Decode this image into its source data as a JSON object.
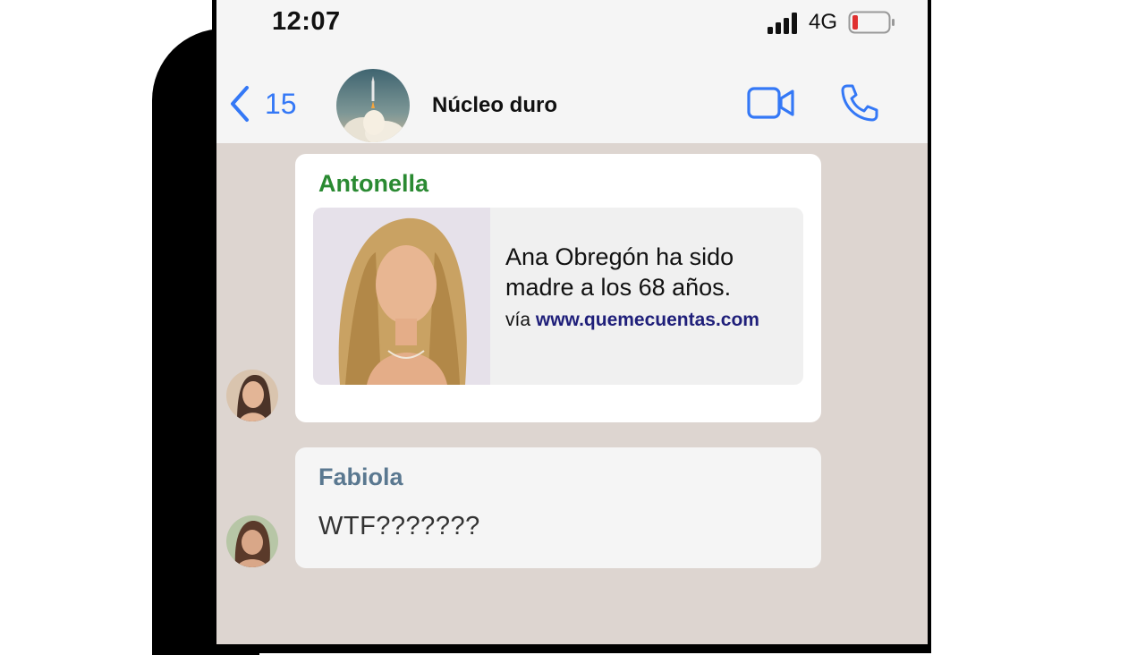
{
  "status_bar": {
    "time": "12:07",
    "network": "4G",
    "battery_color": "#e03030"
  },
  "header": {
    "back_count": "15",
    "group_name": "Núcleo duro",
    "icons": [
      "chevron-left-icon",
      "video-camera-icon",
      "phone-icon"
    ],
    "accent": "#3478f6"
  },
  "messages": [
    {
      "sender": "Antonella",
      "sender_color": "#2a8a32",
      "link_preview": {
        "text": "Ana Obregón ha sido madre a los 68 años.",
        "via_label": "vía",
        "url": "www.quemecuentas.com"
      }
    },
    {
      "sender": "Fabiola",
      "sender_color": "#5a7890",
      "text": "WTF???????"
    }
  ]
}
